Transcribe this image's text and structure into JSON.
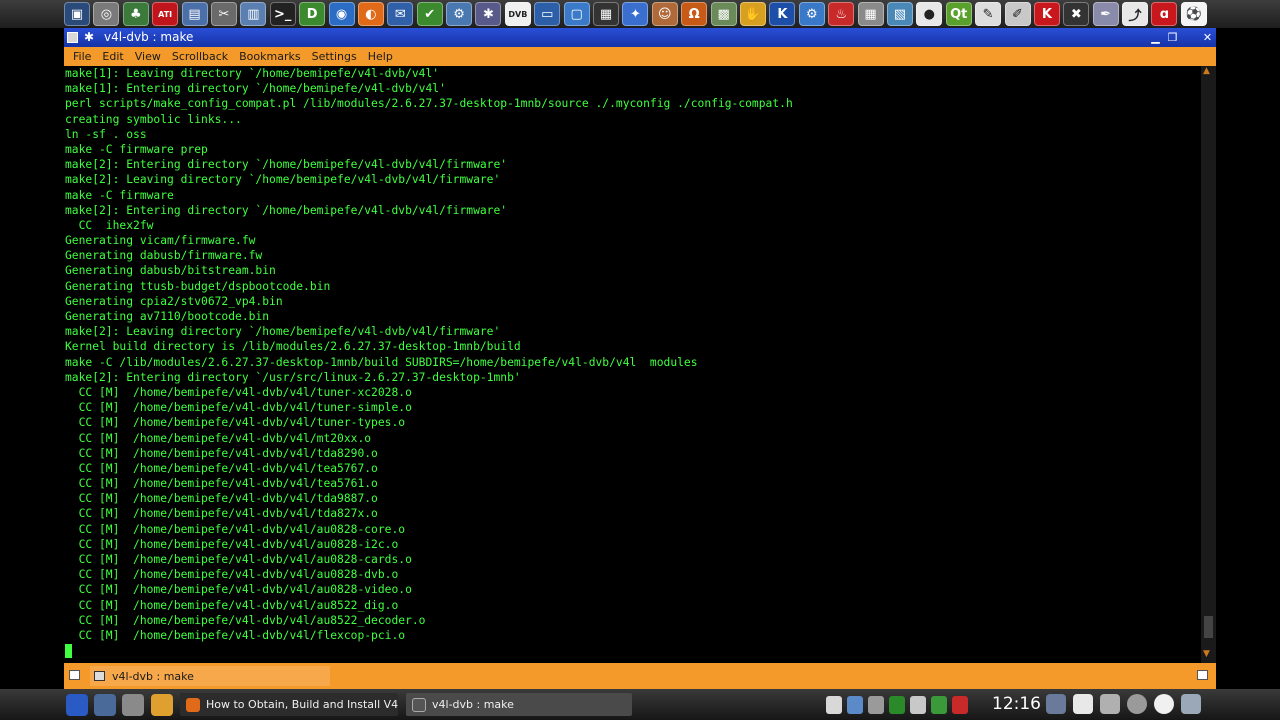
{
  "top_panel": {
    "launchers": [
      {
        "icon": "desktop-icon",
        "glyph": "▣",
        "color": "#2a4a7a"
      },
      {
        "icon": "disk-icon",
        "glyph": "◎",
        "color": "#7a7a7a"
      },
      {
        "icon": "joystick-icon",
        "glyph": "♣",
        "color": "#3b7a3b"
      },
      {
        "icon": "ati-icon",
        "glyph": "ATI",
        "color": "#c0161b"
      },
      {
        "icon": "display-config-icon",
        "glyph": "▤",
        "color": "#4b6fa8"
      },
      {
        "icon": "tools-icon",
        "glyph": "✂",
        "color": "#6a6a6a"
      },
      {
        "icon": "document-icon",
        "glyph": "▥",
        "color": "#5a7fb0"
      },
      {
        "icon": "terminal-icon",
        "glyph": ">_",
        "color": "#222222"
      },
      {
        "icon": "d-icon",
        "glyph": "D",
        "color": "#3c8a2e"
      },
      {
        "icon": "globe-icon",
        "glyph": "◉",
        "color": "#2b6cc4"
      },
      {
        "icon": "firefox-icon",
        "glyph": "◐",
        "color": "#e06a18"
      },
      {
        "icon": "thunderbird-icon",
        "glyph": "✉",
        "color": "#3060a8"
      },
      {
        "icon": "checkmark-icon",
        "glyph": "✔",
        "color": "#3c8a2e"
      },
      {
        "icon": "network-icon",
        "glyph": "⚙",
        "color": "#4a78b0"
      },
      {
        "icon": "settings-icon",
        "glyph": "✱",
        "color": "#5a5a8a"
      },
      {
        "icon": "dvb-icon",
        "glyph": "DVB",
        "color": "#f0f0f0"
      },
      {
        "icon": "monitor-icon",
        "glyph": "▭",
        "color": "#2d5fa8"
      },
      {
        "icon": "screen-icon",
        "glyph": "▢",
        "color": "#3a7ac8"
      },
      {
        "icon": "film-icon",
        "glyph": "▦",
        "color": "#333333"
      },
      {
        "icon": "compass-icon",
        "glyph": "✦",
        "color": "#3a6fd0"
      },
      {
        "icon": "person-icon",
        "glyph": "☺",
        "color": "#b06a3a"
      },
      {
        "icon": "headphones-icon",
        "glyph": "Ω",
        "color": "#c85a18"
      },
      {
        "icon": "image-icon",
        "glyph": "▩",
        "color": "#6a8a5a"
      },
      {
        "icon": "hand-icon",
        "glyph": "✋",
        "color": "#d8a020"
      },
      {
        "icon": "k-icon",
        "glyph": "K",
        "color": "#1e4fa8"
      },
      {
        "icon": "gear-icon",
        "glyph": "⚙",
        "color": "#3a78c8"
      },
      {
        "icon": "flame-icon",
        "glyph": "♨",
        "color": "#c82a2a"
      },
      {
        "icon": "calculator-icon",
        "glyph": "▦",
        "color": "#8a8a8a"
      },
      {
        "icon": "image-editor-icon",
        "glyph": "▧",
        "color": "#4a88b8"
      },
      {
        "icon": "sphere-icon",
        "glyph": "●",
        "color": "#e8e8e8"
      },
      {
        "icon": "qt-icon",
        "glyph": "Qt",
        "color": "#5aa02c"
      },
      {
        "icon": "pencil-icon",
        "glyph": "✎",
        "color": "#dddddd"
      },
      {
        "icon": "notes-icon",
        "glyph": "✐",
        "color": "#c8c8c8"
      },
      {
        "icon": "kate-icon",
        "glyph": "K",
        "color": "#c8181e"
      },
      {
        "icon": "x-icon",
        "glyph": "✖",
        "color": "#333333"
      },
      {
        "icon": "pen-tool-icon",
        "glyph": "✒",
        "color": "#8a8aaa"
      },
      {
        "icon": "chart-icon",
        "glyph": "⤴",
        "color": "#e8e8e8"
      },
      {
        "icon": "swirl-icon",
        "glyph": "ɑ",
        "color": "#c8181e"
      },
      {
        "icon": "soccer-ball-icon",
        "glyph": "⚽",
        "color": "#f4f4f4"
      }
    ]
  },
  "window": {
    "title": "v4l-dvb : make",
    "sticky_glyph": "✱",
    "minimize_glyph": "▁",
    "maximize_glyph": "❐",
    "close_glyph": "✕"
  },
  "menubar": {
    "items": [
      "File",
      "Edit",
      "View",
      "Scrollback",
      "Bookmarks",
      "Settings",
      "Help"
    ]
  },
  "terminal": {
    "scroll_up_glyph": "▲",
    "scroll_down_glyph": "▼",
    "lines": [
      "make[1]: Leaving directory `/home/bemipefe/v4l-dvb/v4l'",
      "make[1]: Entering directory `/home/bemipefe/v4l-dvb/v4l'",
      "perl scripts/make_config_compat.pl /lib/modules/2.6.27.37-desktop-1mnb/source ./.myconfig ./config-compat.h",
      "creating symbolic links...",
      "ln -sf . oss",
      "make -C firmware prep",
      "make[2]: Entering directory `/home/bemipefe/v4l-dvb/v4l/firmware'",
      "make[2]: Leaving directory `/home/bemipefe/v4l-dvb/v4l/firmware'",
      "make -C firmware",
      "make[2]: Entering directory `/home/bemipefe/v4l-dvb/v4l/firmware'",
      "  CC  ihex2fw",
      "Generating vicam/firmware.fw",
      "Generating dabusb/firmware.fw",
      "Generating dabusb/bitstream.bin",
      "Generating ttusb-budget/dspbootcode.bin",
      "Generating cpia2/stv0672_vp4.bin",
      "Generating av7110/bootcode.bin",
      "make[2]: Leaving directory `/home/bemipefe/v4l-dvb/v4l/firmware'",
      "Kernel build directory is /lib/modules/2.6.27.37-desktop-1mnb/build",
      "make -C /lib/modules/2.6.27.37-desktop-1mnb/build SUBDIRS=/home/bemipefe/v4l-dvb/v4l  modules",
      "make[2]: Entering directory `/usr/src/linux-2.6.27.37-desktop-1mnb'",
      "  CC [M]  /home/bemipefe/v4l-dvb/v4l/tuner-xc2028.o",
      "  CC [M]  /home/bemipefe/v4l-dvb/v4l/tuner-simple.o",
      "  CC [M]  /home/bemipefe/v4l-dvb/v4l/tuner-types.o",
      "  CC [M]  /home/bemipefe/v4l-dvb/v4l/mt20xx.o",
      "  CC [M]  /home/bemipefe/v4l-dvb/v4l/tda8290.o",
      "  CC [M]  /home/bemipefe/v4l-dvb/v4l/tea5767.o",
      "  CC [M]  /home/bemipefe/v4l-dvb/v4l/tea5761.o",
      "  CC [M]  /home/bemipefe/v4l-dvb/v4l/tda9887.o",
      "  CC [M]  /home/bemipefe/v4l-dvb/v4l/tda827x.o",
      "  CC [M]  /home/bemipefe/v4l-dvb/v4l/au0828-core.o",
      "  CC [M]  /home/bemipefe/v4l-dvb/v4l/au0828-i2c.o",
      "  CC [M]  /home/bemipefe/v4l-dvb/v4l/au0828-cards.o",
      "  CC [M]  /home/bemipefe/v4l-dvb/v4l/au0828-dvb.o",
      "  CC [M]  /home/bemipefe/v4l-dvb/v4l/au0828-video.o",
      "  CC [M]  /home/bemipefe/v4l-dvb/v4l/au8522_dig.o",
      "  CC [M]  /home/bemipefe/v4l-dvb/v4l/au8522_decoder.o",
      "  CC [M]  /home/bemipefe/v4l-dvb/v4l/flexcop-pci.o"
    ]
  },
  "tabbar": {
    "session_label": "v4l-dvb : make"
  },
  "taskbar": {
    "tasks": [
      {
        "label": "How to Obtain, Build and Install V4L",
        "icon": "firefox-icon",
        "color": "#e06a18"
      },
      {
        "label": "v4l-dvb : make",
        "icon": "terminal-icon",
        "color": "#555555"
      }
    ],
    "clock": "12:16"
  },
  "colors": {
    "terminal_text": "#40ff40",
    "menubar_bg": "#f49a2b",
    "titlebar_bg": "#1f3fc0"
  }
}
